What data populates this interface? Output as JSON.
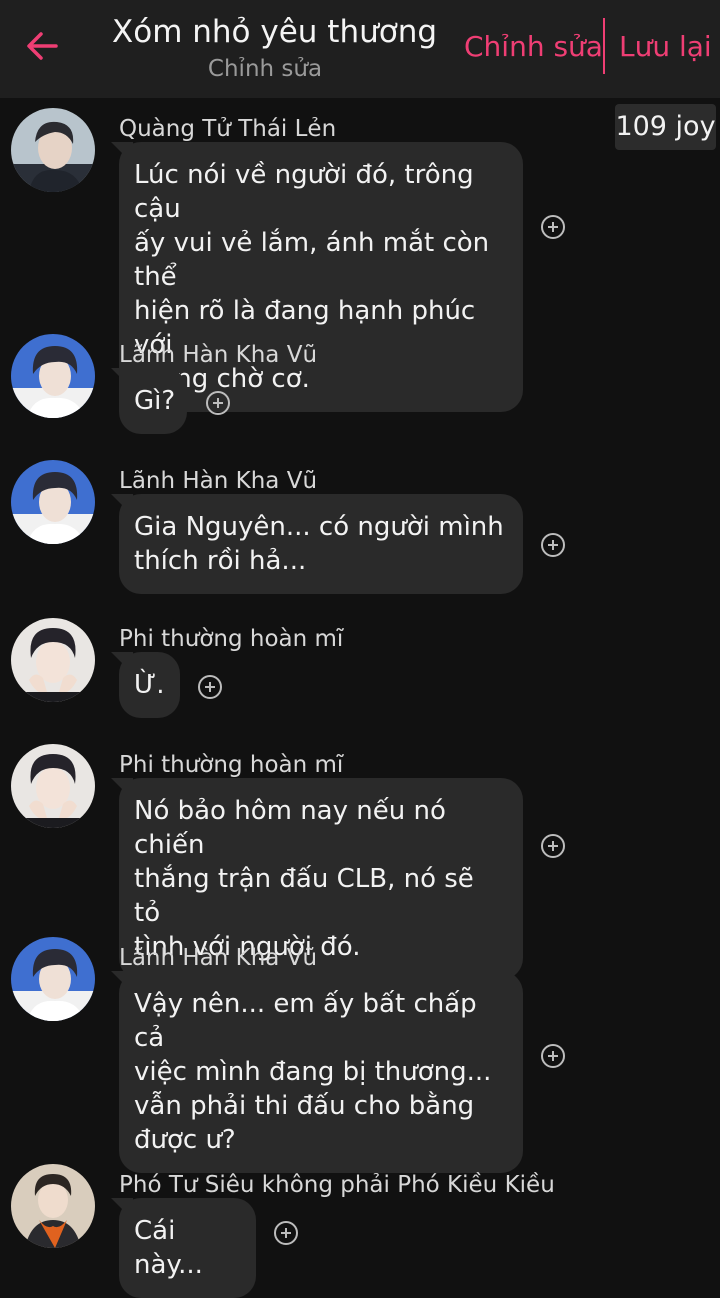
{
  "header": {
    "title": "Xóm nhỏ yêu thương",
    "subtitle": "Chỉnh sửa",
    "edit_label": "Chỉnh sửa",
    "save_label": "Lưu lại",
    "accent_color": "#ef3e74"
  },
  "joy_badge": "109 joy",
  "messages": [
    {
      "sender": "Quàng Tử Thái Lẻn",
      "lines": [
        "Lúc nói về người đó, trông cậu",
        "ấy vui vẻ lắm, ánh mắt còn thể",
        "hiện rõ là đang hạnh phúc với",
        "mong chờ cơ."
      ]
    },
    {
      "sender": "Lãnh Hàn Kha Vũ",
      "lines": [
        "Gì?"
      ]
    },
    {
      "sender": "Lãnh Hàn Kha Vũ",
      "lines": [
        "Gia Nguyên... có người mình",
        "thích rồi hả..."
      ]
    },
    {
      "sender": "Phi thường hoàn mĩ",
      "lines": [
        "Ừ."
      ]
    },
    {
      "sender": "Phi thường hoàn mĩ",
      "lines": [
        "Nó bảo hôm nay nếu nó chiến",
        "thắng trận đấu CLB, nó sẽ tỏ",
        "tình với người đó."
      ]
    },
    {
      "sender": "Lãnh Hàn Kha Vũ",
      "lines": [
        "Vậy nên... em ấy bất chấp cả",
        "việc mình đang bị thương...",
        "vẫn phải thi đấu cho bằng",
        "được ư?"
      ]
    },
    {
      "sender": "Phó Tư Siêu không phải Phó Kiều Kiều",
      "lines": [
        "Cái này..."
      ]
    }
  ],
  "icons": {
    "back": "arrow-left-icon",
    "add_reaction": "plus-circle-icon"
  }
}
